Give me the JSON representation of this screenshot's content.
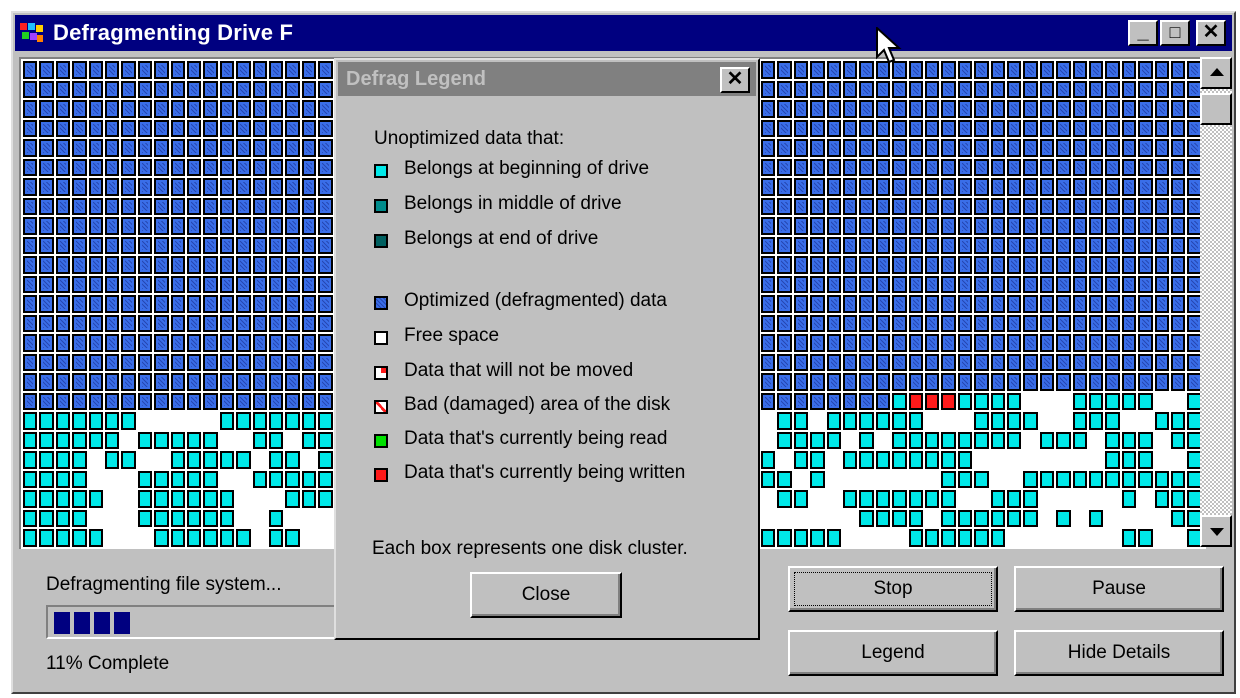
{
  "window": {
    "title": "Defragmenting Drive F",
    "minimize_label": "_",
    "maximize_label": "□",
    "close_label": "✕"
  },
  "status": {
    "text": "Defragmenting file system...",
    "progress_percent": 11,
    "complete_text": "11% Complete"
  },
  "buttons": {
    "stop": "Stop",
    "pause": "Pause",
    "legend": "Legend",
    "hide_details": "Hide Details"
  },
  "legend_dialog": {
    "title": "Defrag Legend",
    "close_x": "✕",
    "intro": "Unoptimized data that:",
    "items": [
      {
        "label": "Belongs at beginning of drive",
        "color": "#00e8e8",
        "icon": "beginning-swatch"
      },
      {
        "label": "Belongs in middle of drive",
        "color": "#008c8c",
        "icon": "middle-swatch"
      },
      {
        "label": "Belongs at end of drive",
        "color": "#006060",
        "icon": "end-swatch"
      },
      {
        "label": "Optimized (defragmented) data",
        "color": "#3a6ee8",
        "icon": "optimized-swatch"
      },
      {
        "label": "Free space",
        "color": "#ffffff",
        "icon": "free-swatch"
      },
      {
        "label": "Data that will not be moved",
        "color": "#ffffff",
        "icon": "unmovable-swatch"
      },
      {
        "label": "Bad (damaged) area of the disk",
        "color": "#ffffff",
        "icon": "bad-swatch"
      },
      {
        "label": "Data that's currently being read",
        "color": "#00e000",
        "icon": "read-swatch"
      },
      {
        "label": "Data that's currently being written",
        "color": "#ff1a1a",
        "icon": "write-swatch"
      }
    ],
    "footnote": "Each box represents one disk cluster.",
    "close_button": "Close"
  },
  "colors": {
    "optimized": "#3a6ee8",
    "beginning": "#00e8e8",
    "writing": "#ff1a1a",
    "free": "#ffffff",
    "titlebar_active": "#000080",
    "titlebar_inactive": "#808080"
  }
}
